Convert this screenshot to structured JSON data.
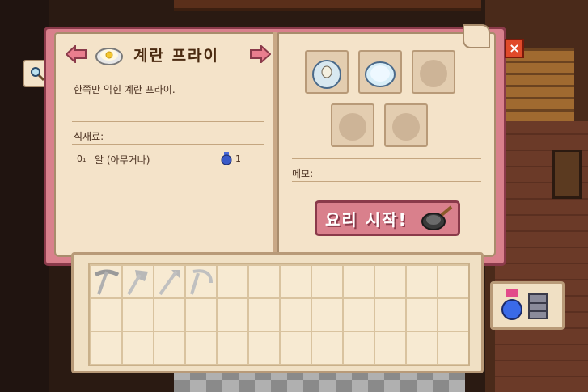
{
  "recipe": {
    "title": "계란 프라이",
    "description": "한쪽만 익힌 계란 프라이.",
    "ingredients_label": "식재료:",
    "ingredients": [
      {
        "quantity": "0₁",
        "name": "알 (아무거나)",
        "count": "1"
      }
    ]
  },
  "right_page": {
    "memo_label": "메모:",
    "cook_button_label": "요리 시작!"
  },
  "controls": {
    "close_label": "×"
  },
  "inventory": {
    "rows": 3,
    "cols": 12,
    "tools": [
      "pickaxe-icon",
      "axe-icon",
      "hoe-icon",
      "scythe-icon"
    ]
  },
  "colors": {
    "book_border": "#d9808c",
    "page": "#f4e3c9",
    "text": "#4a2a10",
    "close": "#e04a2a"
  }
}
